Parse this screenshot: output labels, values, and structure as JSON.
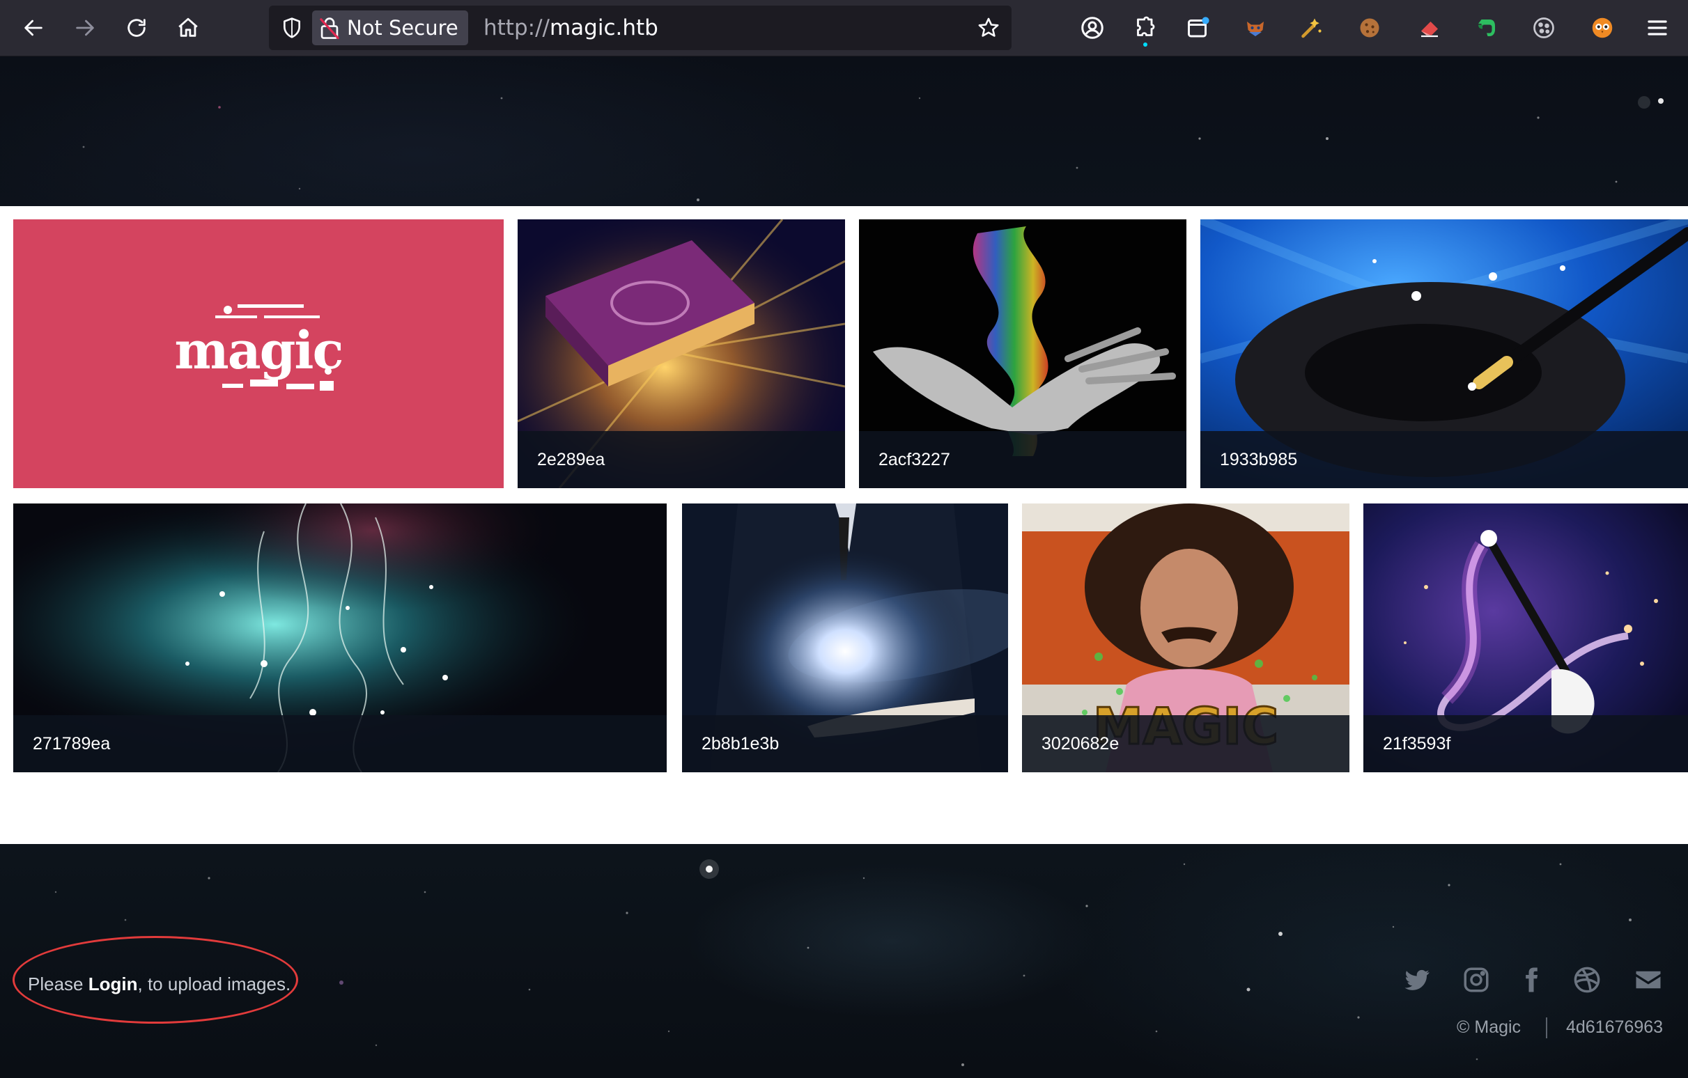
{
  "browser": {
    "not_secure_label": "Not Secure",
    "url_scheme": "http://",
    "url_host": "magic.htb"
  },
  "gallery": {
    "tiles": [
      {
        "caption": "",
        "art": "magic-logo"
      },
      {
        "caption": "2e289ea",
        "art": "glowing-book"
      },
      {
        "caption": "2acf3227",
        "art": "smoke-hand"
      },
      {
        "caption": "1933b985",
        "art": "top-hat-wand"
      },
      {
        "caption": "271789ea",
        "art": "sparkle-swirls"
      },
      {
        "caption": "2b8b1e3b",
        "art": "galaxy-hand"
      },
      {
        "caption": "3020682e",
        "art": "magic-man"
      },
      {
        "caption": "21f3593f",
        "art": "wand-spark"
      }
    ]
  },
  "footer": {
    "note_prefix": "Please ",
    "login_label": "Login",
    "note_suffix": ", to upload images.",
    "copyright": "© Magic",
    "build_id": "4d61676963"
  },
  "colors": {
    "accent_circle": "#e23b3b",
    "logo_tile": "#d4445f"
  }
}
